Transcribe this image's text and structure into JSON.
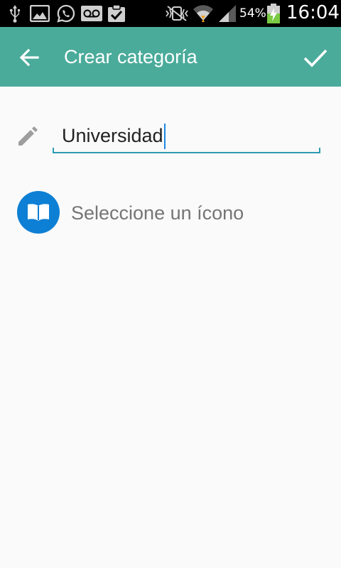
{
  "status_bar": {
    "battery_percent": "54%",
    "time": "16:04",
    "icons": [
      "usb-icon",
      "image-icon",
      "whatsapp-icon",
      "voicemail-icon",
      "clipboard-check-icon",
      "vibrate-mute-icon",
      "wifi-icon",
      "signal-icon",
      "battery-charging-icon"
    ]
  },
  "app_bar": {
    "title": "Crear categoría",
    "background": "#4aab9a",
    "back_icon": "arrow-back-icon",
    "confirm_icon": "check-icon"
  },
  "form": {
    "name_value": "Universidad",
    "name_icon": "pencil-icon",
    "icon_select_label": "Seleccione un ícono",
    "selected_icon": "book-icon",
    "selected_icon_color": "#0d7fd5"
  }
}
